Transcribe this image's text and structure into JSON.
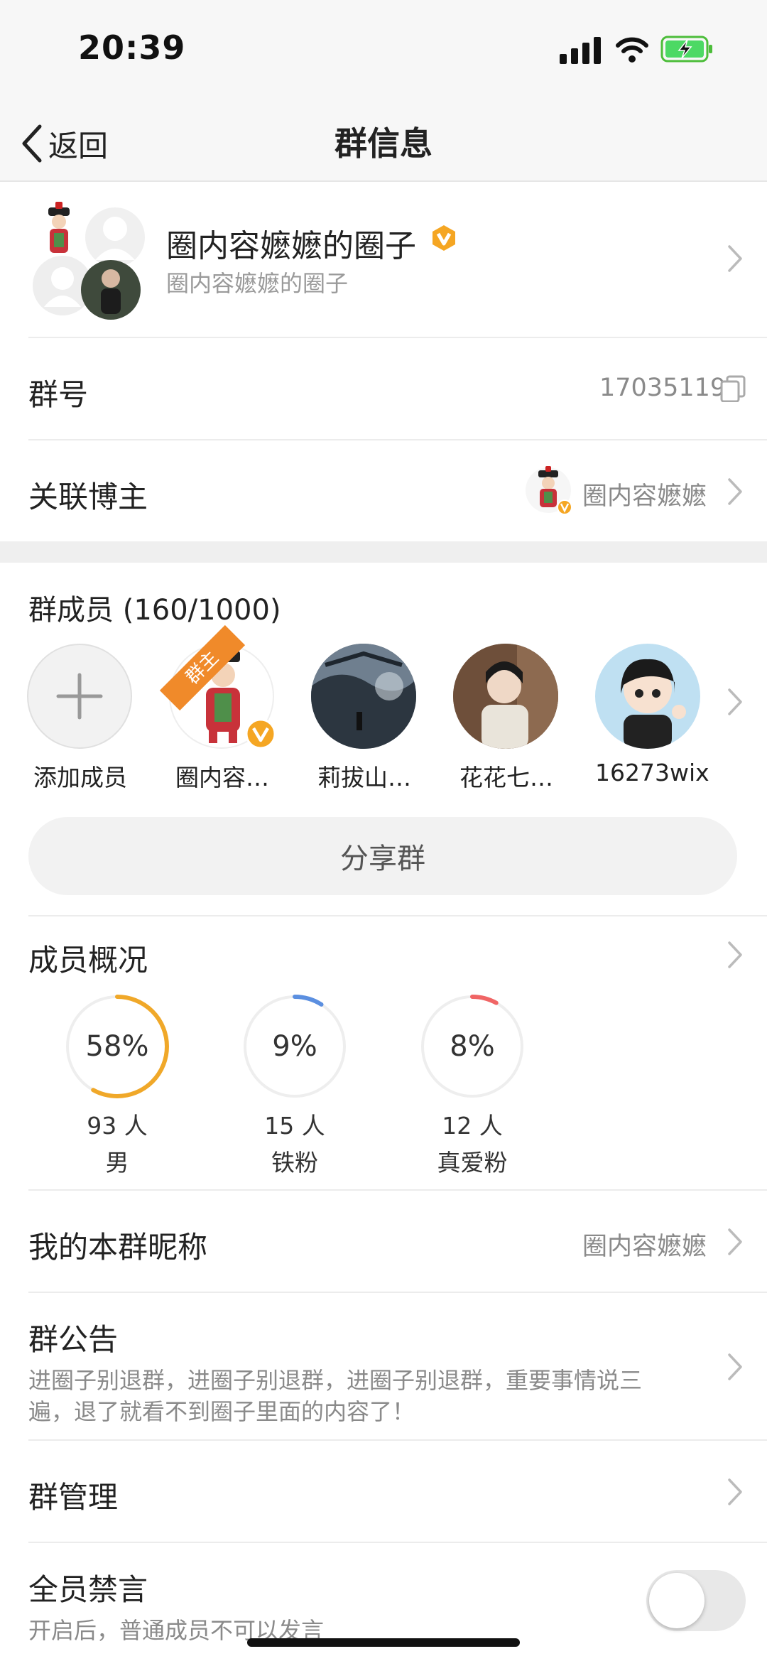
{
  "status": {
    "time": "20:39"
  },
  "nav": {
    "back_label": "返回",
    "title": "群信息"
  },
  "group": {
    "name": "圈内容嬷嬷的圈子",
    "subtitle": "圈内容嬷嬷的圈子",
    "number_label": "群号",
    "number": "17035119",
    "linked_label": "关联博主",
    "linked_name": "圈内容嬷嬷"
  },
  "members": {
    "header": "群成员 (160/1000)",
    "add_label": "添加成员",
    "owner_badge": "群主",
    "items": [
      {
        "name": "圈内容…"
      },
      {
        "name": "莉拔山…"
      },
      {
        "name": "花花七…"
      },
      {
        "name": "16273wix"
      }
    ],
    "share_label": "分享群"
  },
  "overview": {
    "title": "成员概况",
    "stats": [
      {
        "percent_text": "58%",
        "percent": 58,
        "count": "93 人",
        "label": "男",
        "color": "#f0a829"
      },
      {
        "percent_text": "9%",
        "percent": 9,
        "count": "15 人",
        "label": "铁粉",
        "color": "#5b8fe0"
      },
      {
        "percent_text": "8%",
        "percent": 8,
        "count": "12 人",
        "label": "真爱粉",
        "color": "#f06565"
      }
    ]
  },
  "nickname": {
    "label": "我的本群昵称",
    "value": "圈内容嬷嬷"
  },
  "announcement": {
    "label": "群公告",
    "line1": "进圈子别退群，进圈子别退群，进圈子别退群，重要事情说三",
    "line2": "遍，退了就看不到圈子里面的内容了！"
  },
  "manage": {
    "label": "群管理"
  },
  "mute": {
    "label": "全员禁言",
    "desc": "开启后，普通成员不可以发言",
    "enabled": false
  }
}
